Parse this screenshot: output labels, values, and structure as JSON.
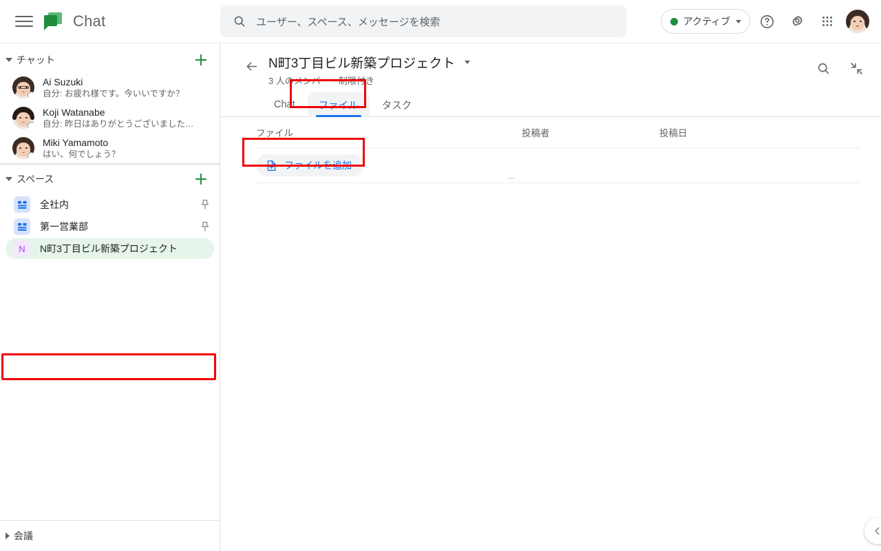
{
  "topbar": {
    "menu_icon": "hamburger-menu-icon",
    "logo_icon": "google-chat-logo",
    "app_title": "Chat",
    "search": {
      "icon": "search-icon",
      "placeholder": "ユーザー、スペース、メッセージを検索",
      "value": ""
    },
    "status": {
      "label": "アクティブ",
      "dot_color": "#1e8e3e",
      "caret_icon": "chevron-down-icon"
    },
    "help_icon": "help-circle-icon",
    "settings_icon": "gear-icon",
    "apps_icon": "apps-grid-icon",
    "account_avatar": "user-avatar"
  },
  "sidebar": {
    "chat_section": {
      "label": "チャット",
      "collapse_icon": "triangle-down-icon",
      "add_icon": "plus-icon",
      "items": [
        {
          "name": "Ai Suzuki",
          "preview": "自分: お疲れ様です。今いいですか？",
          "avatar": "contact-avatar"
        },
        {
          "name": "Koji Watanabe",
          "preview": "自分: 昨日はありがとうございました…",
          "avatar": "contact-avatar"
        },
        {
          "name": "Miki Yamamoto",
          "preview": "はい、何でしょう？",
          "avatar": "contact-avatar"
        }
      ]
    },
    "spaces_section": {
      "label": "スペース",
      "collapse_icon": "triangle-down-icon",
      "add_icon": "plus-icon",
      "items": [
        {
          "label": "全社内",
          "icon": "group-space-icon",
          "pinned": true,
          "active": false
        },
        {
          "label": "第一営業部",
          "icon": "group-space-icon",
          "pinned": true,
          "active": false
        },
        {
          "label": "N町3丁目ビル新築プロジェクト",
          "icon": "N",
          "pinned": false,
          "active": true,
          "highlight_color": "#e6f4ea"
        }
      ]
    },
    "meet_section": {
      "label": "会議",
      "collapse_icon": "triangle-right-icon"
    }
  },
  "main": {
    "back_icon": "back-arrow-icon",
    "space_title": "N町3丁目ビル新築プロジェクト",
    "title_caret_icon": "chevron-down-icon",
    "space_subtitle": "3 人のメンバー・制限付き",
    "header_actions": [
      {
        "icon": "search-icon",
        "name": "search-in-space"
      },
      {
        "icon": "collapse-arrows-icon",
        "name": "collapse-view"
      }
    ],
    "tabs": [
      {
        "label": "Chat",
        "active": false
      },
      {
        "label": "ファイル",
        "active": true
      },
      {
        "label": "タスク",
        "active": false
      }
    ],
    "files": {
      "columns": [
        "ファイル",
        "投稿者",
        "投稿日"
      ],
      "add_button": {
        "label": "ファイルを追加",
        "icon": "file-add-icon"
      },
      "rows": []
    },
    "collapse_pill_icon": "chevron-left-icon"
  },
  "annotations": {
    "color": "#f00000",
    "targets": [
      "files-tab",
      "add-file-button",
      "active-space-row"
    ]
  }
}
